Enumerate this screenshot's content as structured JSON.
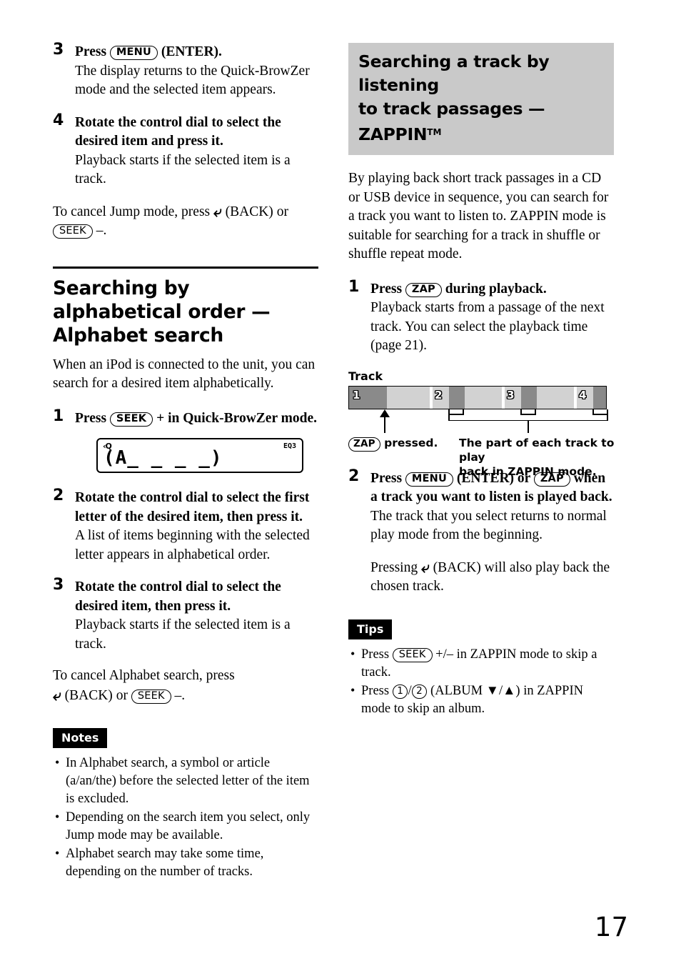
{
  "page_number": "17",
  "left_column": {
    "steps_continued": [
      {
        "num": "3",
        "title_pre": "Press ",
        "title_button": "MENU",
        "title_post": " (ENTER).",
        "body": "The display returns to the Quick-BrowZer mode and the selected item appears."
      },
      {
        "num": "4",
        "title": "Rotate the control dial to select the desired item and press it.",
        "body": "Playback starts if the selected item is a track."
      }
    ],
    "cancel_jump": {
      "text_1": "To cancel Jump mode, press ",
      "back_label": "(BACK)",
      "text_2": " or ",
      "seek_button": "SEEK",
      "text_3": " –."
    },
    "section": {
      "heading": "Searching by alphabetical order — Alphabet search",
      "intro": "When an iPod is connected to the unit, you can search for a desired item alphabetically.",
      "steps": [
        {
          "num": "1",
          "title_pre": "Press ",
          "title_button": "SEEK",
          "title_post": " + in Quick-BrowZer mode."
        },
        {
          "num": "2",
          "title": "Rotate the control dial to select the first letter of the desired item, then press it.",
          "body": "A list of items beginning with the selected letter appears in alphabetical order."
        },
        {
          "num": "3",
          "title": "Rotate the control dial to select the desired item, then press it.",
          "body": "Playback starts if the selected item is a track."
        }
      ],
      "lcd": {
        "magnifier_icon": "search-icon",
        "magnifier_text": "‹Q",
        "eq_indicator": "EQ3",
        "segment_text": "(A_ _ _ _)"
      },
      "cancel_alphabet": {
        "text_1": "To cancel Alphabet search, press",
        "back_label": "(BACK)",
        "text_2": " or ",
        "seek_button": "SEEK",
        "text_3": " –."
      }
    },
    "notes": {
      "banner": "Notes",
      "items": [
        "In Alphabet search, a symbol or article (a/an/the) before the selected letter of the item is excluded.",
        "Depending on the search item you select, only Jump mode may be available.",
        "Alphabet search may take some time, depending on the number of tracks."
      ]
    }
  },
  "right_column": {
    "heading_line1": "Searching a track by listening",
    "heading_line2_pre": "to track passages — ZAPPIN",
    "heading_trademark": "TM",
    "intro": "By playing back short track passages in a CD or USB device in sequence, you can search for a track you want to listen to. ZAPPIN mode is suitable for searching for a track in shuffle or shuffle repeat mode.",
    "steps": [
      {
        "num": "1",
        "title_pre": "Press ",
        "title_button": "ZAP",
        "title_post": " during playback.",
        "body": "Playback starts from a passage of the next track. You can select the playback time (page 21)."
      },
      {
        "num": "2",
        "title_pre": "Press ",
        "title_button_1": "MENU",
        "title_mid": " (ENTER) or ",
        "title_button_2": "ZAP",
        "title_post": " when a track you want to listen is played back.",
        "body": "The track that you select returns to normal play mode from the beginning.",
        "extra_pre": "Pressing ",
        "extra_back": "(BACK)",
        "extra_post": " will also play back the chosen track."
      }
    ],
    "diagram": {
      "label": "Track",
      "tracks": [
        "1",
        "2",
        "3",
        "4"
      ],
      "caption_left_button": "ZAP",
      "caption_left_text": " pressed.",
      "caption_right_line1": "The part of each track to play",
      "caption_right_line2": "back in ZAPPIN mode.",
      "colors": {
        "track_light": "#d2d2d2",
        "track_dark": "#8a8a8a",
        "divider": "#ffffff",
        "outline": "#000000"
      }
    },
    "tips": {
      "banner": "Tips",
      "items": [
        {
          "pre": "Press ",
          "button": "SEEK",
          "post": " +/– in ZAPPIN mode to skip a track."
        },
        {
          "pre": "Press ",
          "button_1": "1",
          "sep": "/",
          "button_2": "2",
          "post": " (ALBUM ▼/▲) in ZAPPIN mode to skip an album."
        }
      ]
    }
  },
  "heading_box_color": "#c9c9c9"
}
